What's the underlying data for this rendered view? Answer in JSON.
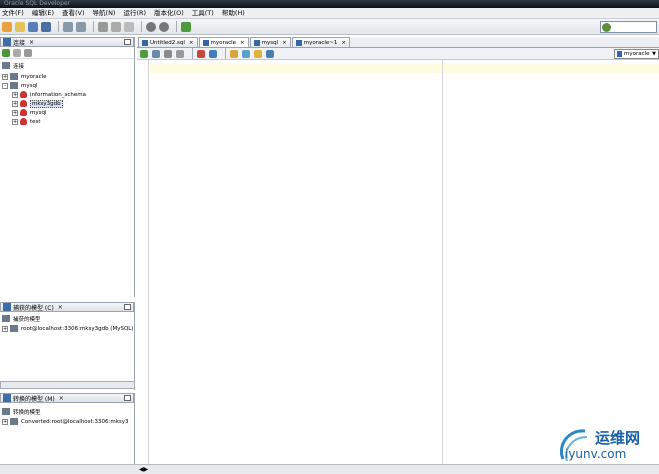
{
  "window": {
    "title": "Oracle SQL Developer"
  },
  "menu": [
    "文件(F)",
    "编辑(E)",
    "查看(V)",
    "导航(N)",
    "运行(R)",
    "版本化(O)",
    "工具(T)",
    "帮助(H)"
  ],
  "connections_panel": {
    "tab_label": "连接",
    "root_label": "连接",
    "items": [
      {
        "label": "myoracle",
        "level": 1,
        "expander": "+"
      },
      {
        "label": "mysql",
        "level": 1,
        "expander": "-"
      },
      {
        "label": "information_schema",
        "level": 2,
        "expander": "+"
      },
      {
        "label": "mksy3gdb",
        "level": 2,
        "expander": "+",
        "selected": true
      },
      {
        "label": "mysql",
        "level": 2,
        "expander": "+"
      },
      {
        "label": "test",
        "level": 2,
        "expander": "+"
      }
    ]
  },
  "captured_panel": {
    "tab_label": "捕获的模型 (C)",
    "root_label": "捕获的模型",
    "item": "root@localhost:3306:mksy3gdb (MySQL)"
  },
  "converted_panel": {
    "tab_label": "转换的模型 (M)",
    "root_label": "转换的模型",
    "item": "Converted:root@localhost:3306:mksy3"
  },
  "editor_tabs": [
    {
      "label": "Untitled2.sql",
      "active": false
    },
    {
      "label": "myoracle",
      "active": true
    },
    {
      "label": "mysql",
      "active": false
    },
    {
      "label": "myoracle~1",
      "active": false
    }
  ],
  "connection_select": {
    "value": "myoracle"
  },
  "watermark": {
    "brand": "运维网",
    "url": "iyunv.com"
  },
  "colors": {
    "accent": "#3e6da8",
    "current_line": "#fdfbe0",
    "titlebar": "#0d1218"
  }
}
